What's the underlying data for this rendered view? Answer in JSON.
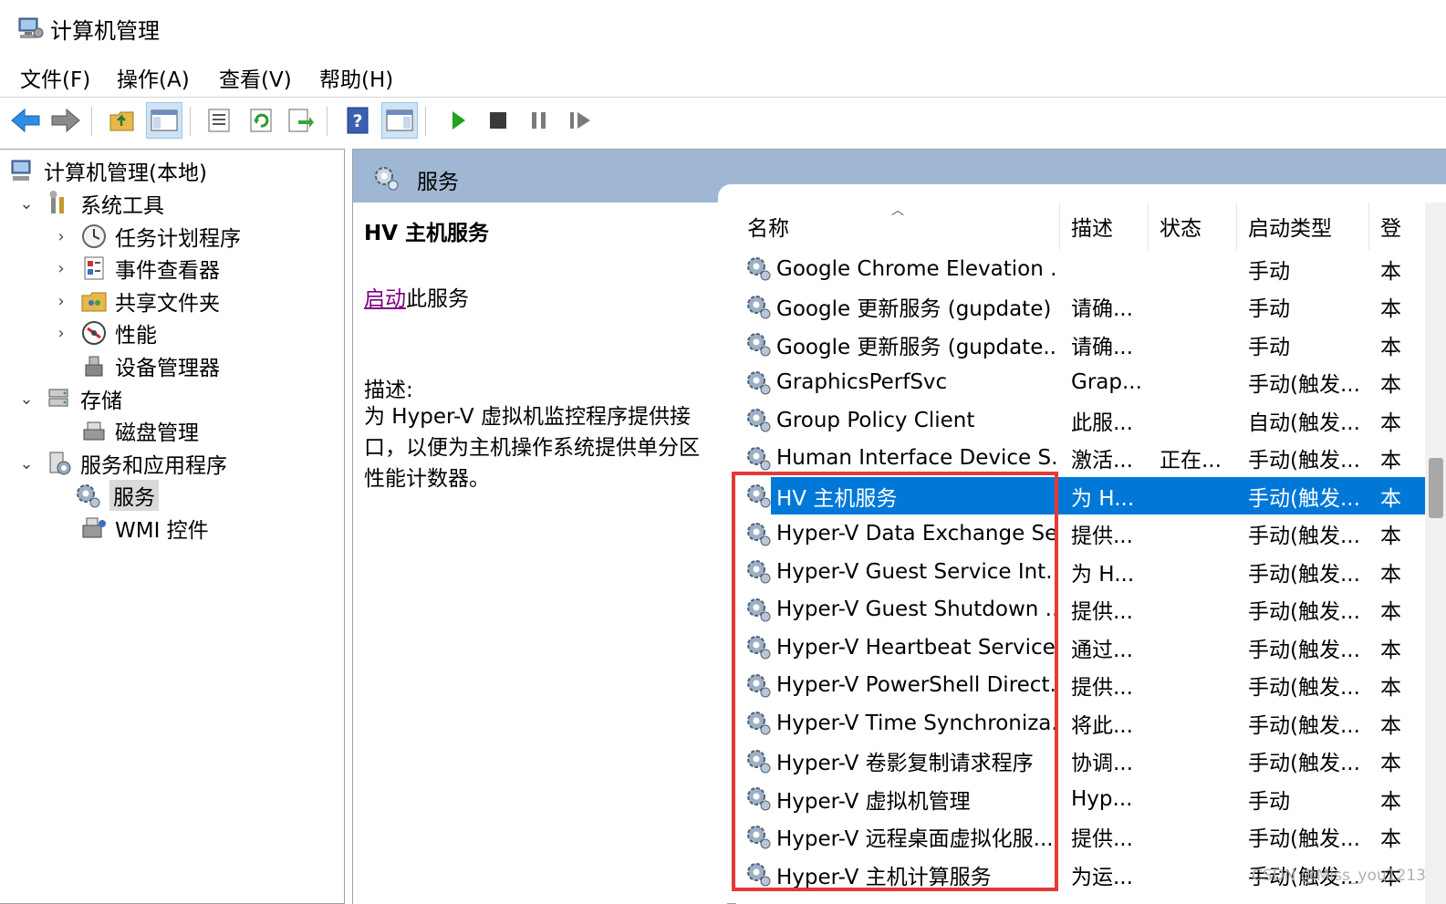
{
  "window": {
    "title": "计算机管理"
  },
  "menu": [
    "文件(F)",
    "操作(A)",
    "查看(V)",
    "帮助(H)"
  ],
  "toolbar": {
    "buttons": [
      "back-icon",
      "forward-icon",
      "up-folder-icon",
      "show-hide-tree-icon",
      "properties-icon",
      "refresh-icon",
      "export-icon",
      "help-icon",
      "show-action-pane-icon",
      "start-service-icon",
      "stop-service-icon",
      "pause-service-icon",
      "resume-service-icon"
    ]
  },
  "tree": {
    "root": "计算机管理(本地)",
    "system_tools": "系统工具",
    "task_scheduler": "任务计划程序",
    "event_viewer": "事件查看器",
    "shared_folders": "共享文件夹",
    "performance": "性能",
    "device_manager": "设备管理器",
    "storage": "存储",
    "disk_management": "磁盘管理",
    "services_apps": "服务和应用程序",
    "services": "服务",
    "wmi": "WMI 控件"
  },
  "header": {
    "title": "服务"
  },
  "description": {
    "service_name": "HV 主机服务",
    "start_link": "启动",
    "start_suffix": "此服务",
    "label": "描述:",
    "text": "为 Hyper-V 虚拟机监控程序提供接口，以便为主机操作系统提供单分区性能计数器。"
  },
  "columns": {
    "name": "名称",
    "desc": "描述",
    "status": "状态",
    "startup": "启动类型",
    "logon": "登"
  },
  "rows": [
    {
      "name": "Google Chrome Elevation ...",
      "desc": "",
      "status": "",
      "startup": "手动",
      "logon": "本"
    },
    {
      "name": "Google 更新服务 (gupdate)",
      "desc": "请确...",
      "status": "",
      "startup": "手动",
      "logon": "本"
    },
    {
      "name": "Google 更新服务 (gupdate...",
      "desc": "请确...",
      "status": "",
      "startup": "手动",
      "logon": "本"
    },
    {
      "name": "GraphicsPerfSvc",
      "desc": "Grap...",
      "status": "",
      "startup": "手动(触发...",
      "logon": "本"
    },
    {
      "name": "Group Policy Client",
      "desc": "此服...",
      "status": "",
      "startup": "自动(触发...",
      "logon": "本"
    },
    {
      "name": "Human Interface Device S...",
      "desc": "激活...",
      "status": "正在...",
      "startup": "手动(触发...",
      "logon": "本"
    },
    {
      "name": "HV 主机服务",
      "desc": "为 H...",
      "status": "",
      "startup": "手动(触发...",
      "logon": "本"
    },
    {
      "name": "Hyper-V Data Exchange Se...",
      "desc": "提供...",
      "status": "",
      "startup": "手动(触发...",
      "logon": "本"
    },
    {
      "name": "Hyper-V Guest Service Int...",
      "desc": "为 H...",
      "status": "",
      "startup": "手动(触发...",
      "logon": "本"
    },
    {
      "name": "Hyper-V Guest Shutdown ...",
      "desc": "提供...",
      "status": "",
      "startup": "手动(触发...",
      "logon": "本"
    },
    {
      "name": "Hyper-V Heartbeat Service",
      "desc": "通过...",
      "status": "",
      "startup": "手动(触发...",
      "logon": "本"
    },
    {
      "name": "Hyper-V PowerShell Direct...",
      "desc": "提供...",
      "status": "",
      "startup": "手动(触发...",
      "logon": "本"
    },
    {
      "name": "Hyper-V Time Synchroniza...",
      "desc": "将此...",
      "status": "",
      "startup": "手动(触发...",
      "logon": "本"
    },
    {
      "name": "Hyper-V 卷影复制请求程序",
      "desc": "协调...",
      "status": "",
      "startup": "手动(触发...",
      "logon": "本"
    },
    {
      "name": "Hyper-V 虚拟机管理",
      "desc": "Hyp...",
      "status": "",
      "startup": "手动",
      "logon": "本"
    },
    {
      "name": "Hyper-V 远程桌面虚拟化服...",
      "desc": "提供...",
      "status": "",
      "startup": "手动(触发...",
      "logon": "本"
    },
    {
      "name": "Hyper-V 主机计算服务",
      "desc": "为运...",
      "status": "",
      "startup": "手动(触发...",
      "logon": "本"
    }
  ],
  "selected_row": 6,
  "watermark": "CSDN @Miss_you1213",
  "colors": {
    "selection": "#0078d7",
    "header_band": "#9fb7d2",
    "highlight_box": "#e53935",
    "link_visited": "#800080"
  }
}
